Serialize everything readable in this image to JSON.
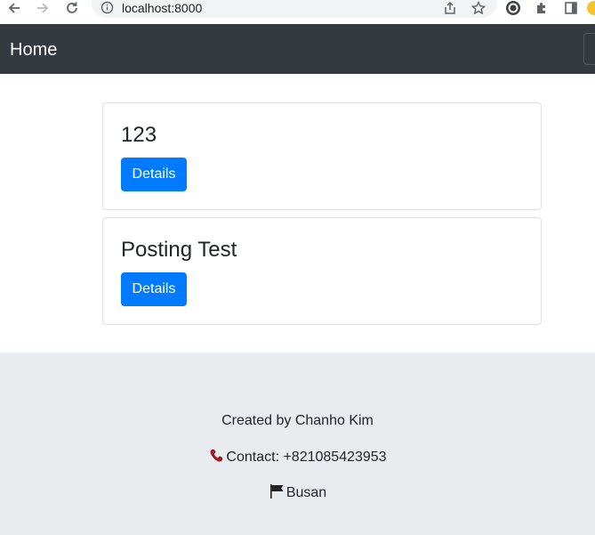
{
  "browser": {
    "url": "localhost:8000"
  },
  "navbar": {
    "brand": "Home"
  },
  "posts": [
    {
      "title": "123",
      "button_label": "Details"
    },
    {
      "title": "Posting Test",
      "button_label": "Details"
    }
  ],
  "footer": {
    "created_by": "Created by Chanho Kim",
    "contact": "Contact: +821085423953",
    "location": "Busan",
    "contact_icon": "telephone-receiver-icon",
    "location_icon": "black-flag-icon"
  },
  "colors": {
    "navbar_bg": "#343a40",
    "primary": "#007bff",
    "footer_bg": "#e9ecef"
  }
}
